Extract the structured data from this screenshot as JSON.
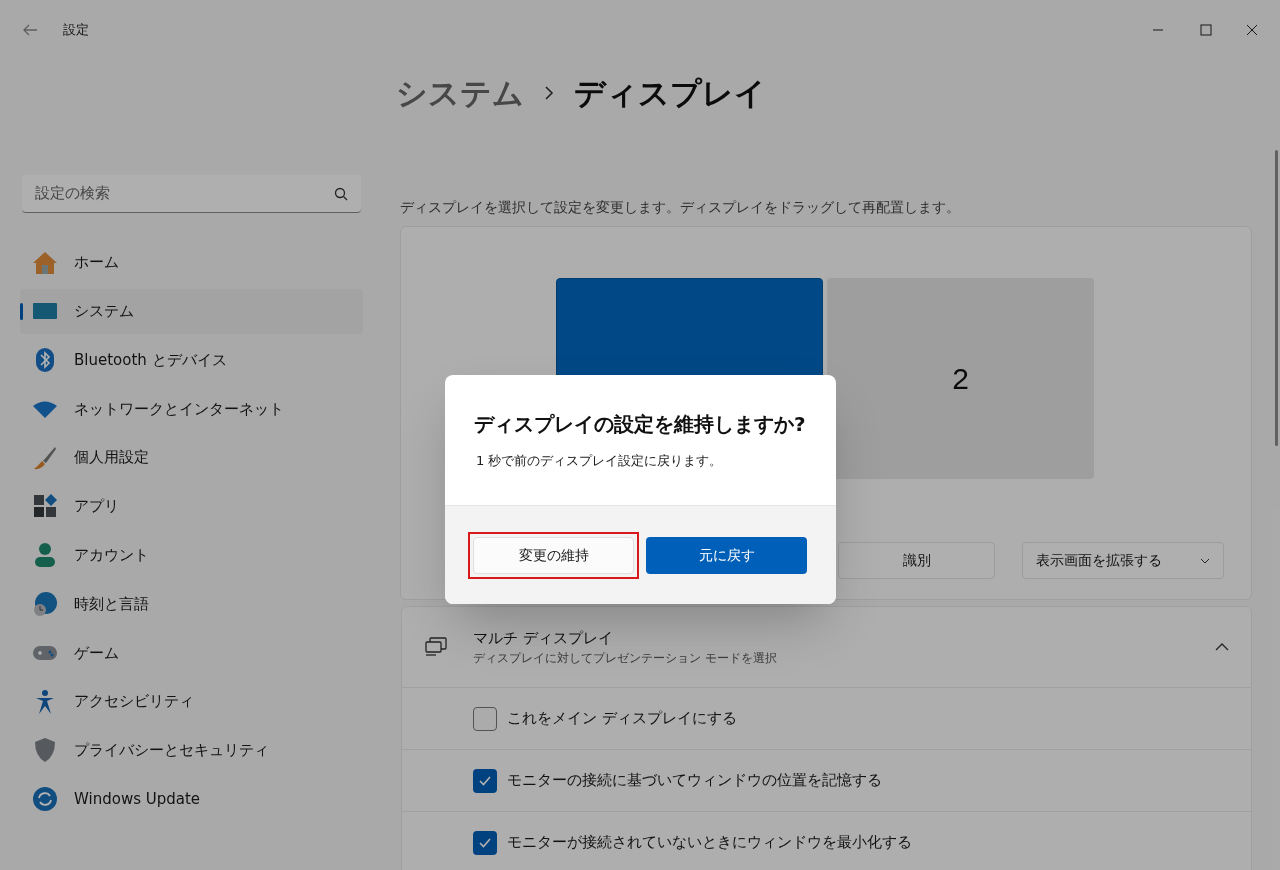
{
  "window": {
    "title": "設定"
  },
  "search": {
    "placeholder": "設定の検索"
  },
  "sidebar": {
    "items": [
      {
        "label": "ホーム",
        "selected": false
      },
      {
        "label": "システム",
        "selected": true
      },
      {
        "label": "Bluetooth とデバイス",
        "selected": false
      },
      {
        "label": "ネットワークとインターネット",
        "selected": false
      },
      {
        "label": "個人用設定",
        "selected": false
      },
      {
        "label": "アプリ",
        "selected": false
      },
      {
        "label": "アカウント",
        "selected": false
      },
      {
        "label": "時刻と言語",
        "selected": false
      },
      {
        "label": "ゲーム",
        "selected": false
      },
      {
        "label": "アクセシビリティ",
        "selected": false
      },
      {
        "label": "プライバシーとセキュリティ",
        "selected": false
      },
      {
        "label": "Windows Update",
        "selected": false
      }
    ]
  },
  "breadcrumb": [
    "システム",
    "ディスプレイ"
  ],
  "description": "ディスプレイを選択して設定を変更します。ディスプレイをドラッグして再配置します。",
  "monitors": [
    {
      "selected": true
    },
    {
      "label": "2",
      "selected": false
    }
  ],
  "identify_button": "識別",
  "extend_dropdown": "表示画面を拡張する",
  "multi_display": {
    "title": "マルチ ディスプレイ",
    "subtitle": "ディスプレイに対してプレゼンテーション モードを選択",
    "expanded": true,
    "options": [
      {
        "label": "これをメイン ディスプレイにする",
        "checked": false
      },
      {
        "label": "モニターの接続に基づいてウィンドウの位置を記憶する",
        "checked": true
      },
      {
        "label": "モニターが接続されていないときにウィンドウを最小化する",
        "checked": true
      }
    ]
  },
  "dialog": {
    "title": "ディスプレイの設定を維持しますか?",
    "message": "1 秒で前のディスプレイ設定に戻ります。",
    "buttons": [
      {
        "label": "変更の維持",
        "primary": false,
        "highlighted": true
      },
      {
        "label": "元に戻す",
        "primary": true,
        "highlighted": false
      }
    ]
  }
}
